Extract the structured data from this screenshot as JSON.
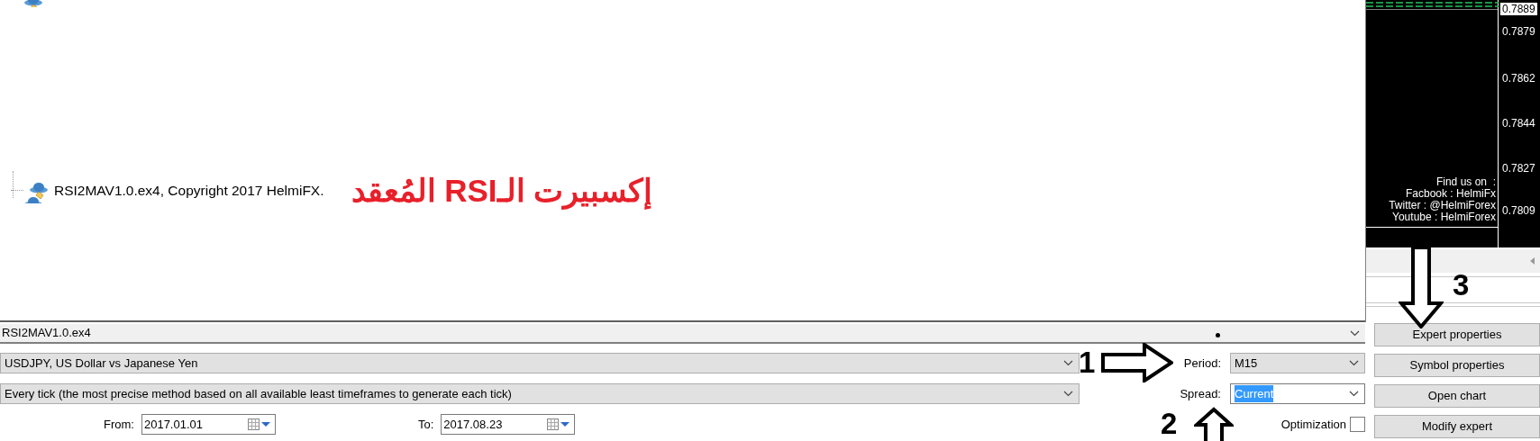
{
  "tree": {
    "items": [
      {
        "label": "RSI2MAV1.0.ex4, Copyright 2017 HelmiFX."
      }
    ]
  },
  "caption": "إكسبيرت الـRSI المُعقد",
  "chart": {
    "price_labels": [
      {
        "text": "0.7889",
        "current": true
      },
      {
        "text": "0.7879",
        "current": false
      },
      {
        "text": "0.7862",
        "current": false
      },
      {
        "text": "0.7844",
        "current": false
      },
      {
        "text": "0.7827",
        "current": false
      },
      {
        "text": "0.7809",
        "current": false
      }
    ],
    "info_lines": [
      "Find us on  :",
      "Facbook : HelmiFx",
      "Twitter : @HelmiForex",
      "Youtube : HelmiForex"
    ]
  },
  "settings": {
    "expert": "RSI2MAV1.0.ex4",
    "symbol": "USDJPY, US Dollar vs Japanese Yen",
    "model": "Every tick (the most precise method based on all available least timeframes to generate each tick)",
    "from_label": "From:",
    "from": "2017.01.01",
    "to_label": "To:",
    "to": "2017.08.23",
    "period_label": "Period:",
    "period": "M15",
    "spread_label": "Spread:",
    "spread": {
      "value": "Current",
      "highlighted": true
    },
    "optimization_label": "Optimization",
    "optimization_checked": false
  },
  "buttons": [
    "Expert properties",
    "Symbol properties",
    "Open chart",
    "Modify expert"
  ],
  "annotations": [
    {
      "number": "1",
      "kind": "right"
    },
    {
      "number": "2",
      "kind": "up"
    },
    {
      "number": "3",
      "kind": "down"
    }
  ]
}
